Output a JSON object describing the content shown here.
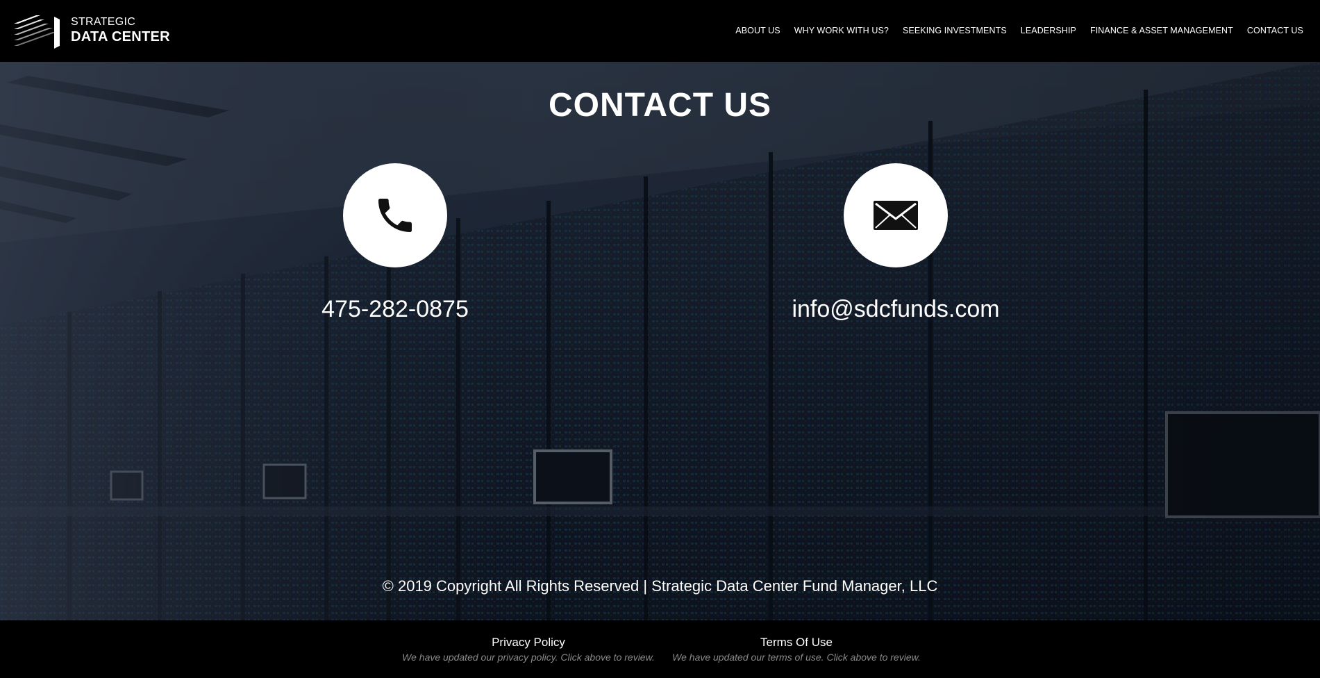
{
  "header": {
    "logo": {
      "line1": "STRATEGIC",
      "line2": "DATA CENTER"
    },
    "nav": [
      {
        "label": "ABOUT US"
      },
      {
        "label": "WHY WORK WITH US?"
      },
      {
        "label": "SEEKING INVESTMENTS"
      },
      {
        "label": "LEADERSHIP"
      },
      {
        "label": "FINANCE & ASSET MANAGEMENT"
      },
      {
        "label": "CONTACT US"
      }
    ]
  },
  "main": {
    "title": "CONTACT US",
    "phone": {
      "icon": "phone-icon",
      "value": "475-282-0875"
    },
    "email": {
      "icon": "envelope-icon",
      "value": "info@sdcfunds.com"
    },
    "copyright": "© 2019 Copyright All Rights Reserved | Strategic Data Center Fund Manager, LLC"
  },
  "footer": {
    "privacy": {
      "label": "Privacy Policy",
      "note": "We have updated our privacy policy. Click above to review."
    },
    "terms": {
      "label": "Terms Of Use",
      "note": "We have updated our terms of use. Click above to review."
    }
  },
  "colors": {
    "header_bg": "#000000",
    "footer_bg": "#000000",
    "text": "#ffffff",
    "note": "#8a8a8a"
  }
}
